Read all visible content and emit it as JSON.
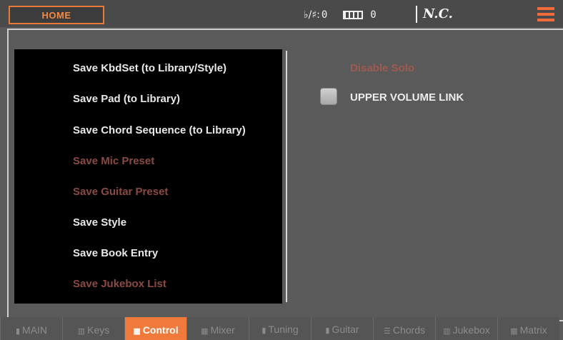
{
  "header": {
    "home_label": "HOME",
    "transpose_icon": "♭/♯:",
    "transpose_value": "0",
    "keyboard_icon": "keyboard-icon",
    "keyboard_value": "0",
    "chord": "N.C."
  },
  "menu": {
    "items": [
      {
        "label": "Save KbdSet (to Library/Style)",
        "enabled": true
      },
      {
        "label": "Save Pad (to Library)",
        "enabled": true
      },
      {
        "label": "Save Chord Sequence (to Library)",
        "enabled": true
      },
      {
        "label": "Save Mic Preset",
        "enabled": false
      },
      {
        "label": "Save Guitar Preset",
        "enabled": false
      },
      {
        "label": "Save Style",
        "enabled": true
      },
      {
        "label": "Save Book Entry",
        "enabled": true
      },
      {
        "label": "Save Jukebox List",
        "enabled": false
      }
    ]
  },
  "options": {
    "disable_solo": "Disable Solo",
    "upper_volume_link": "UPPER VOLUME LINK"
  },
  "tabs": [
    {
      "label": "MAIN",
      "icon": "▮"
    },
    {
      "label": "Keys",
      "icon": "▥"
    },
    {
      "label": "Control",
      "icon": "▦",
      "active": true
    },
    {
      "label": "Mixer",
      "icon": "▦"
    },
    {
      "label": "Tuning",
      "icon": "▮"
    },
    {
      "label": "Guitar",
      "icon": "▮"
    },
    {
      "label": "Chords",
      "icon": "☰"
    },
    {
      "label": "Jukebox",
      "icon": "▥"
    },
    {
      "label": "Matrix",
      "icon": "▦"
    }
  ],
  "colors": {
    "accent": "#ef7a3c",
    "disabled_text": "#8a4a44"
  }
}
